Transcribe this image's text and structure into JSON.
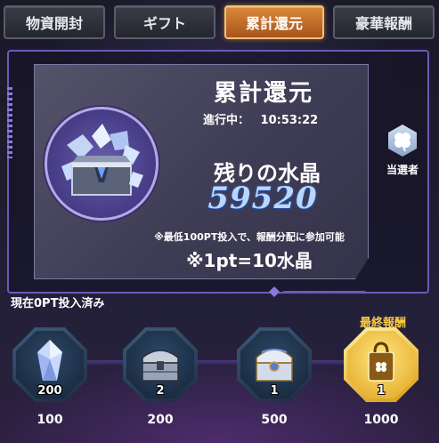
{
  "tabs": [
    {
      "label": "物資開封",
      "active": false
    },
    {
      "label": "ギフト",
      "active": false
    },
    {
      "label": "累計還元",
      "active": true
    },
    {
      "label": "豪華報酬",
      "active": false
    }
  ],
  "panel": {
    "title": "累計還元",
    "progress_label": "進行中：",
    "progress_time": "10:53:22",
    "crystal_label": "残りの水晶",
    "crystal_value": "59520",
    "note": "※最低100PT投入で、報酬分配に参加可能",
    "rate": "※1pt=10水晶"
  },
  "winner": {
    "label": "当選者",
    "icon": "clover-icon"
  },
  "status": "現在0PT投入済み",
  "final_label": "最終報酬",
  "rewards": [
    {
      "icon": "crystal-icon",
      "count": "200",
      "threshold": "100"
    },
    {
      "icon": "silver-chest-icon",
      "count": "2",
      "threshold": "200"
    },
    {
      "icon": "ornate-chest-icon",
      "count": "1",
      "threshold": "500"
    },
    {
      "icon": "gift-bag-icon",
      "count": "1",
      "threshold": "1000"
    }
  ],
  "colors": {
    "active_tab": "#d9893a",
    "frame": "#6b5ab8",
    "crystal_value": "#b9d6ff",
    "final_gold": "#ffcc44"
  }
}
